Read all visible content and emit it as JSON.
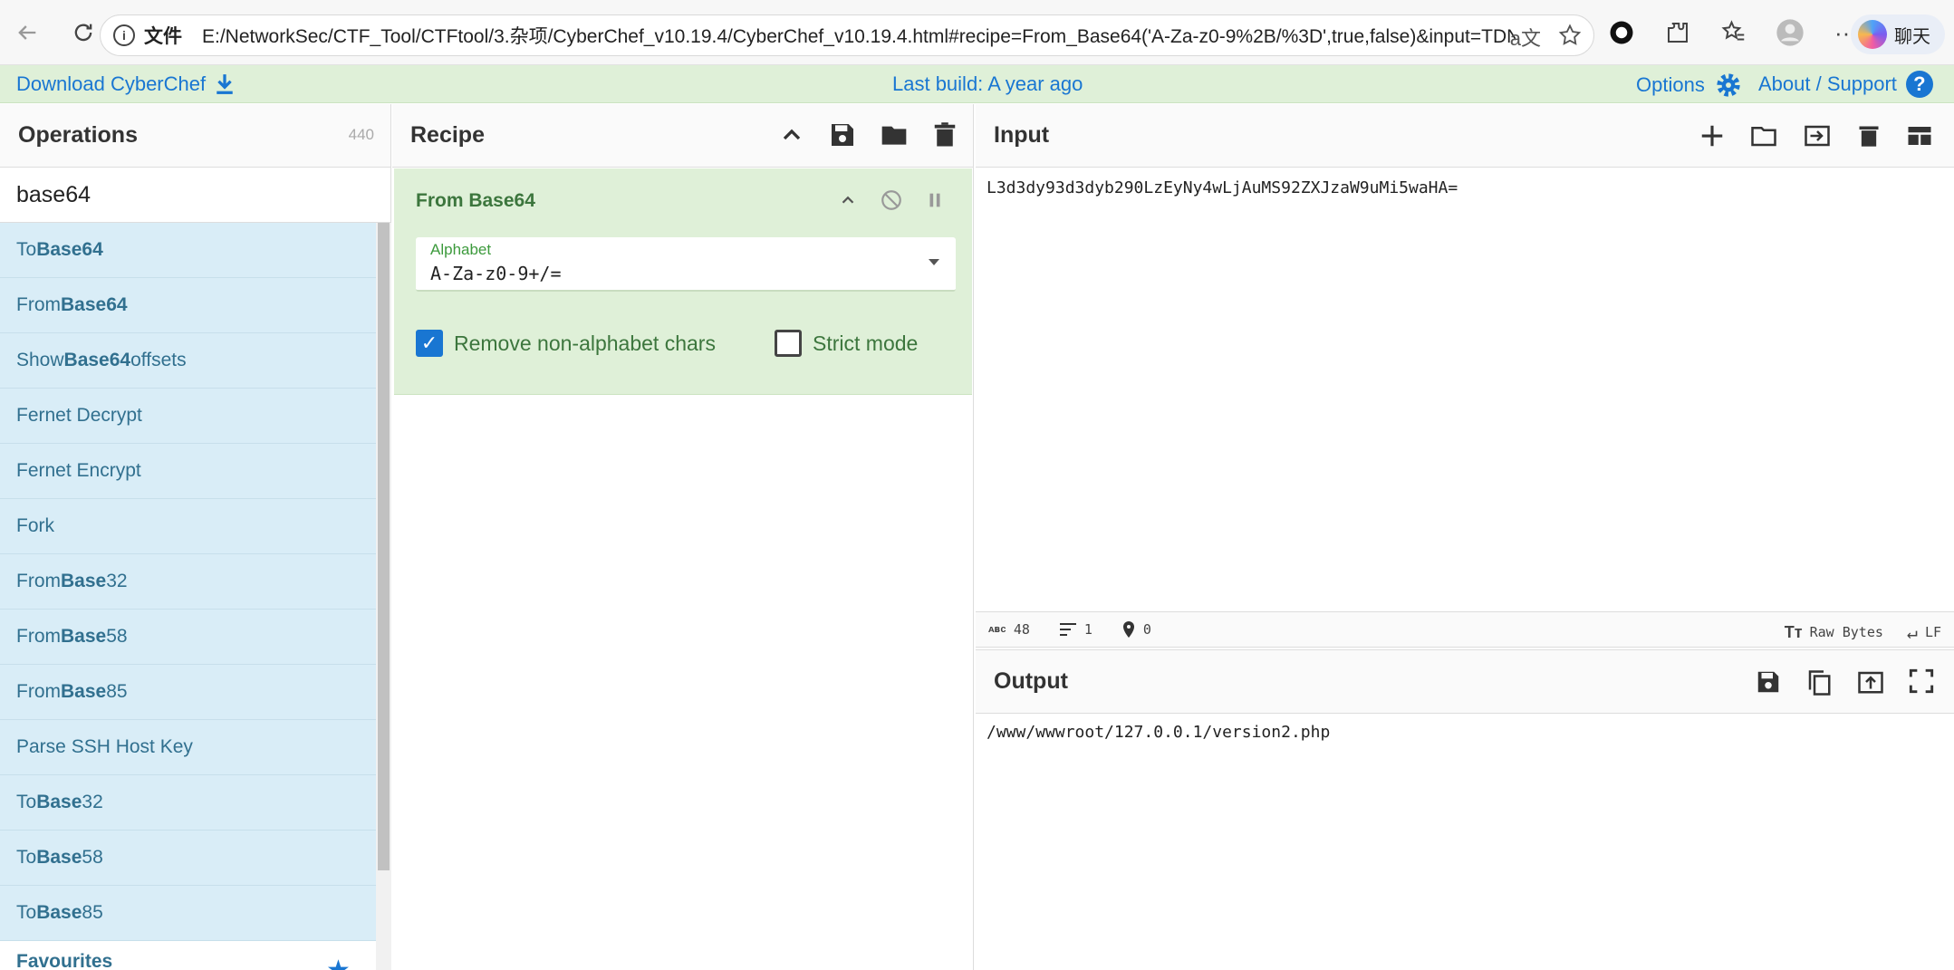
{
  "browser": {
    "scheme_label": "文件",
    "url": "E:/NetworkSec/CTF_Tool/CTFtool/3.杂项/CyberChef_v10.19.4/CyberChef_v10.19.4.html#recipe=From_Base64('A-Za-z0-9%2B/%3D',true,false)&input=TDNk...",
    "chat_label": "聊天"
  },
  "banner": {
    "download_label": "Download CyberChef",
    "build_label": "Last build: A year ago",
    "options_label": "Options",
    "about_label": "About / Support"
  },
  "operations": {
    "title": "Operations",
    "count": "440",
    "search_value": "base64",
    "items": [
      {
        "pre": "To ",
        "bold": "Base64",
        "post": ""
      },
      {
        "pre": "From ",
        "bold": "Base64",
        "post": ""
      },
      {
        "pre": "Show ",
        "bold": "Base64",
        "post": " offsets"
      },
      {
        "pre": "Fernet Decrypt",
        "bold": "",
        "post": ""
      },
      {
        "pre": "Fernet Encrypt",
        "bold": "",
        "post": ""
      },
      {
        "pre": "Fork",
        "bold": "",
        "post": ""
      },
      {
        "pre": "From ",
        "bold": "Base",
        "post": "32"
      },
      {
        "pre": "From ",
        "bold": "Base",
        "post": "58"
      },
      {
        "pre": "From ",
        "bold": "Base",
        "post": "85"
      },
      {
        "pre": "Parse SSH Host Key",
        "bold": "",
        "post": ""
      },
      {
        "pre": "To ",
        "bold": "Base",
        "post": "32"
      },
      {
        "pre": "To ",
        "bold": "Base",
        "post": "58"
      },
      {
        "pre": "To ",
        "bold": "Base",
        "post": "85"
      }
    ],
    "favourites_label": "Favourites"
  },
  "recipe": {
    "title": "Recipe",
    "ingredient": {
      "title": "From Base64",
      "alphabet_label": "Alphabet",
      "alphabet_value": "A-Za-z0-9+/=",
      "remove_label": "Remove non-alphabet chars",
      "remove_checked": true,
      "strict_label": "Strict mode",
      "strict_checked": false
    }
  },
  "input": {
    "title": "Input",
    "text": "L3d3dy93d3dyb290LzEyNy4wLjAuMS92ZXJzaW9uMi5waHA=",
    "status": {
      "abc_label": "ᴀʙᴄ",
      "chars": "48",
      "lines": "1",
      "selection": "0",
      "encoding": "Raw Bytes",
      "eol": "LF"
    }
  },
  "output": {
    "title": "Output",
    "text": "/www/wwwroot/127.0.0.1/version2.php"
  },
  "colors": {
    "banner": "#dff0d8",
    "ops_item": "#d9edf7",
    "link": "#1976d2",
    "ingredient_text": "#3c763d"
  }
}
